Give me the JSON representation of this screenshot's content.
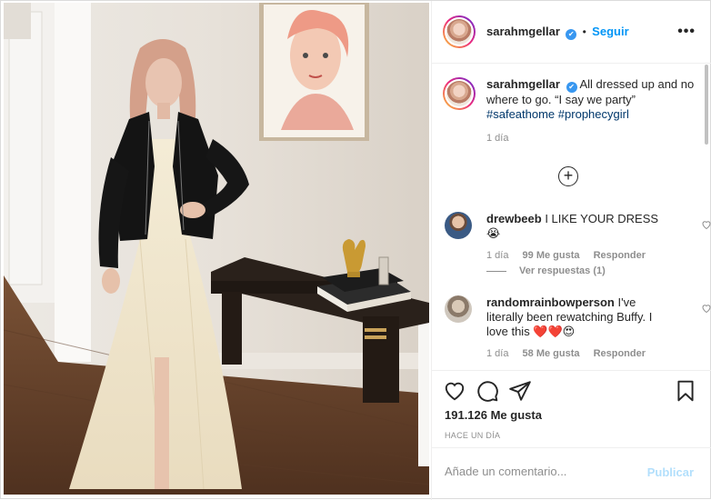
{
  "post": {
    "username": "sarahmgellar",
    "follow_label": "Seguir",
    "separator": "•",
    "more_label": "•••",
    "verified_glyph": "✔"
  },
  "caption": {
    "username": "sarahmgellar",
    "text": "All dressed up and no where to go. “I say we party”",
    "hashtags": [
      "#safeathome",
      "#prophecygirl"
    ],
    "time": "1 día"
  },
  "load_more_icon": "plus-circle-icon",
  "comments": [
    {
      "username": "drewbeeb",
      "text": "I LIKE YOUR DRESS 😭",
      "time": "1 día",
      "likes": "99 Me gusta",
      "reply_label": "Responder",
      "view_replies": "Ver respuestas (1)"
    },
    {
      "username": "randomrainbowperson",
      "text": "I've literally been rewatching Buffy. I love this ❤️❤️😍",
      "time": "1 día",
      "likes": "58 Me gusta",
      "reply_label": "Responder"
    }
  ],
  "actions": {
    "icons": [
      "heart-icon",
      "comment-icon",
      "share-icon",
      "bookmark-icon"
    ],
    "likes_count": "191.126 Me gusta",
    "posted_ago": "HACE UN DÍA"
  },
  "add_comment": {
    "placeholder": "Añade un comentario...",
    "publish_label": "Publicar"
  },
  "colors": {
    "link_blue": "#0095f6",
    "hashtag": "#00376b",
    "muted": "#8e8e8e",
    "publish_disabled": "#b2dffc",
    "verified": "#3897f0"
  }
}
